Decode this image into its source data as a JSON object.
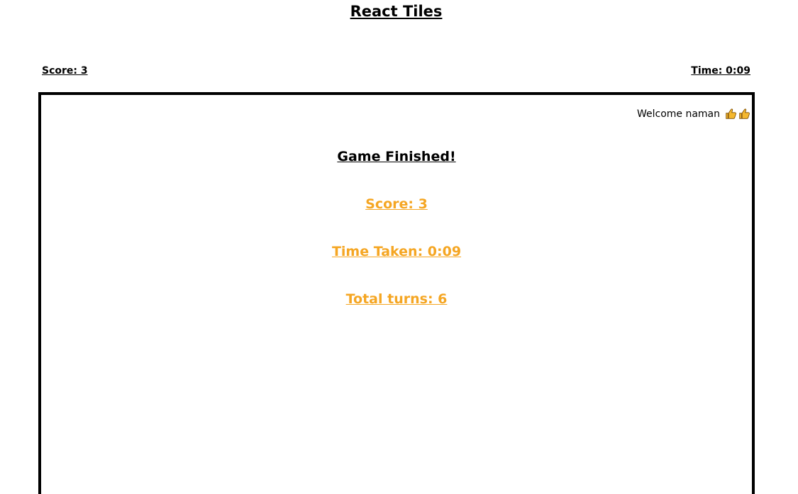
{
  "app": {
    "title": "React Tiles"
  },
  "header": {
    "score": "Score: 3",
    "time": "Time: 0:09"
  },
  "board": {
    "welcome": "Welcome naman",
    "welcome_icons": [
      "thumbs-up-icon",
      "thumbs-up-icon"
    ],
    "finished_title": "Game Finished!",
    "result_score": "Score: 3",
    "result_time": "Time Taken: 0:09",
    "result_turns": "Total turns: 6"
  },
  "colors": {
    "accent": "#f5a623",
    "border": "#000000"
  }
}
